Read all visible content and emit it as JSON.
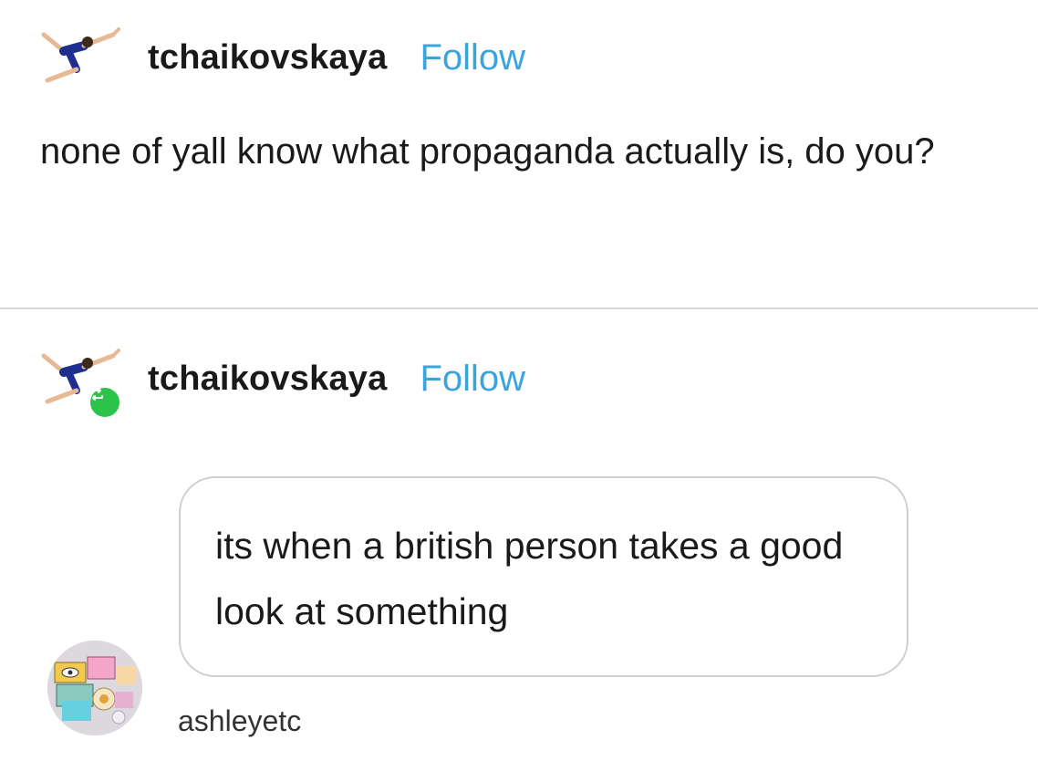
{
  "colors": {
    "follow": "#3aa5dc",
    "reblog_badge": "#2cc34a",
    "divider": "#d7d7d7",
    "bubble_border": "#cfcfcf"
  },
  "original_post": {
    "username": "tchaikovskaya",
    "follow_label": "Follow",
    "avatar_icon": "gymnast-avatar-icon",
    "text": "none of yall know what propaganda actually is, do you?"
  },
  "reblog": {
    "username": "tchaikovskaya",
    "follow_label": "Follow",
    "avatar_icon": "gymnast-avatar-icon",
    "badge_icon": "reblog-icon",
    "answer": {
      "text": "its when a british person takes a good look at something",
      "asker": "ashleyetc",
      "asker_icon": "collage-avatar-icon"
    }
  }
}
